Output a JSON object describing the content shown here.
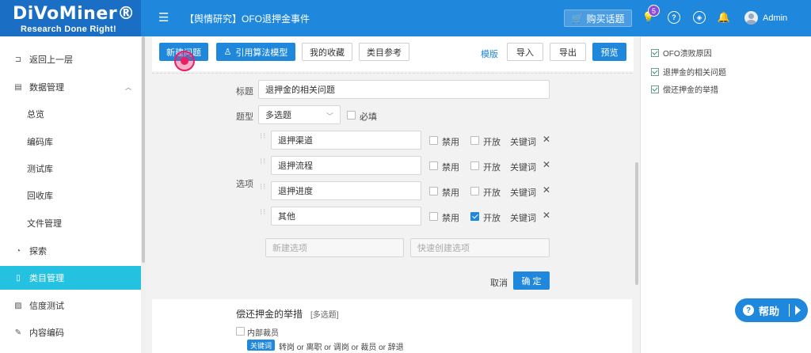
{
  "app": {
    "logo_text": "DiVoMiner®",
    "logo_tagline": "Research Done Right!",
    "project_title": "【舆情研究】OFO退押金事件",
    "buy_button": "购买话题",
    "notification_count": "5",
    "user_name": "Admin",
    "accent_color": "#1f88dd"
  },
  "sidebar": {
    "items": [
      {
        "label": "返回上一层",
        "icon": "back-icon"
      },
      {
        "label": "数据管理",
        "icon": "document-icon"
      },
      {
        "label": "总览"
      },
      {
        "label": "编码库"
      },
      {
        "label": "测试库"
      },
      {
        "label": "回收库"
      },
      {
        "label": "文件管理"
      },
      {
        "label": "探索",
        "icon": "explore-icon"
      },
      {
        "label": "类目管理",
        "icon": "category-icon",
        "active": true
      },
      {
        "label": "信度测试",
        "icon": "reliability-icon"
      },
      {
        "label": "内容编码",
        "icon": "edit-icon"
      }
    ]
  },
  "toolbar": {
    "new_question": "新建问题",
    "import_algorithm": "引用算法模型",
    "my_favorites": "我的收藏",
    "category_reference": "类目参考",
    "template": "模版",
    "import": "导入",
    "export": "导出",
    "preview": "预览"
  },
  "editor": {
    "title_label": "标题",
    "title_value": "退押金的相关问题",
    "type_label": "题型",
    "type_value": "多选题",
    "required_label": "必填",
    "options_label": "选项",
    "options": [
      {
        "value": "退押渠道",
        "disable": "禁用",
        "open": "开放",
        "open_checked": false,
        "keywords": "关键词"
      },
      {
        "value": "退押流程",
        "disable": "禁用",
        "open": "开放",
        "open_checked": false,
        "keywords": "关键词"
      },
      {
        "value": "退押进度",
        "disable": "禁用",
        "open": "开放",
        "open_checked": false,
        "keywords": "关键词"
      },
      {
        "value": "其他",
        "disable": "禁用",
        "open": "开放",
        "open_checked": true,
        "keywords": "关键词"
      }
    ],
    "new_option_placeholder": "新建选项",
    "quick_option_placeholder": "快速创建选项",
    "cancel": "取消",
    "confirm": "确 定"
  },
  "next_question": {
    "title": "偿还押金的举措",
    "type_tag": "[多选题]",
    "option_label": "内部裁员",
    "keyword_tag": "关键词",
    "keywords": "转岗 or 离职 or 调岗 or 裁员 or 辞退"
  },
  "right_panel": {
    "items": [
      "OFO溃败原因",
      "退押金的相关问题",
      "偿还押金的举措"
    ]
  },
  "help": {
    "label": "帮助"
  }
}
